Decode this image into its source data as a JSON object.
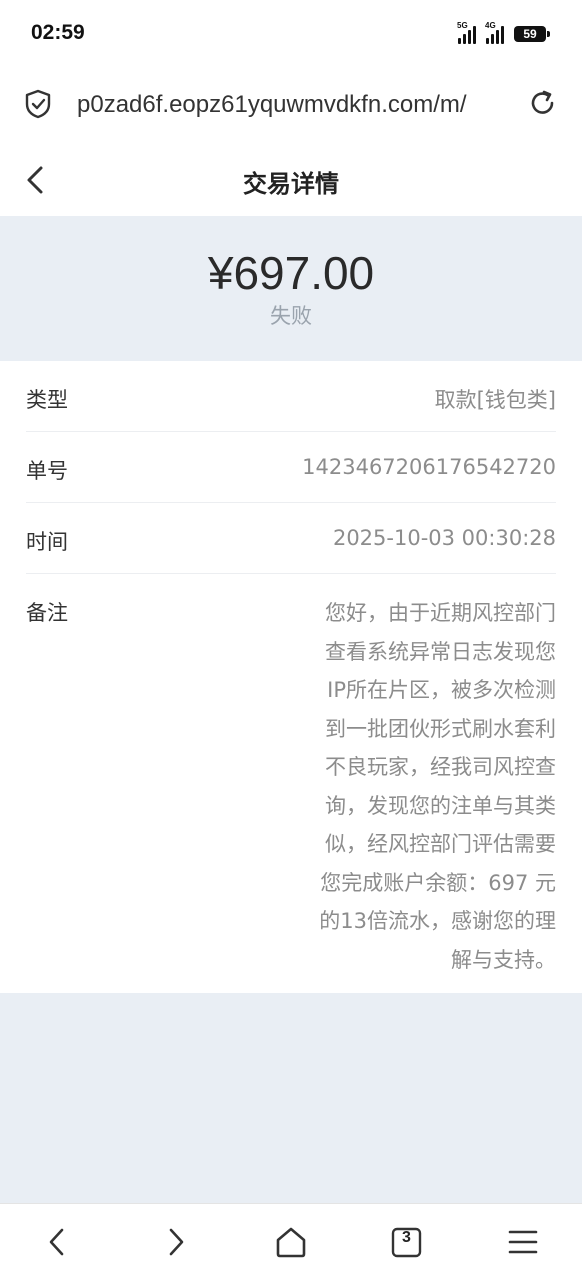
{
  "status_bar": {
    "time": "02:59",
    "signal1_label": "5G",
    "signal2_label": "4G",
    "battery": "59"
  },
  "browser": {
    "url": "p0zad6f.eopz61yquwmvdkfn.com/m/",
    "tab_count": "3"
  },
  "header": {
    "title": "交易详情"
  },
  "summary": {
    "amount": "¥697.00",
    "status": "失败"
  },
  "details": [
    {
      "label": "类型",
      "value": "取款[钱包类]"
    },
    {
      "label": "单号",
      "value": "1423467206176542720"
    },
    {
      "label": "时间",
      "value": "2025-10-03 00:30:28"
    }
  ],
  "note": {
    "label": "备注",
    "lines": [
      "您好，由于近期风控部门",
      "查看系统异常日志发现您",
      "IP所在片区，被多次检测",
      "到一批团伙形式刷水套利",
      "不良玩家，经我司风控查",
      "询，发现您的注单与其类",
      "似，经风控部门评估需要",
      "您完成账户余额：697 元",
      "的13倍流水，感谢您的理",
      "解与支持。"
    ]
  },
  "icons": [
    "shield-check-icon",
    "reload-icon",
    "back-arrow-icon",
    "browser-back-icon",
    "browser-forward-icon",
    "home-icon",
    "tabs-icon",
    "menu-icon"
  ]
}
